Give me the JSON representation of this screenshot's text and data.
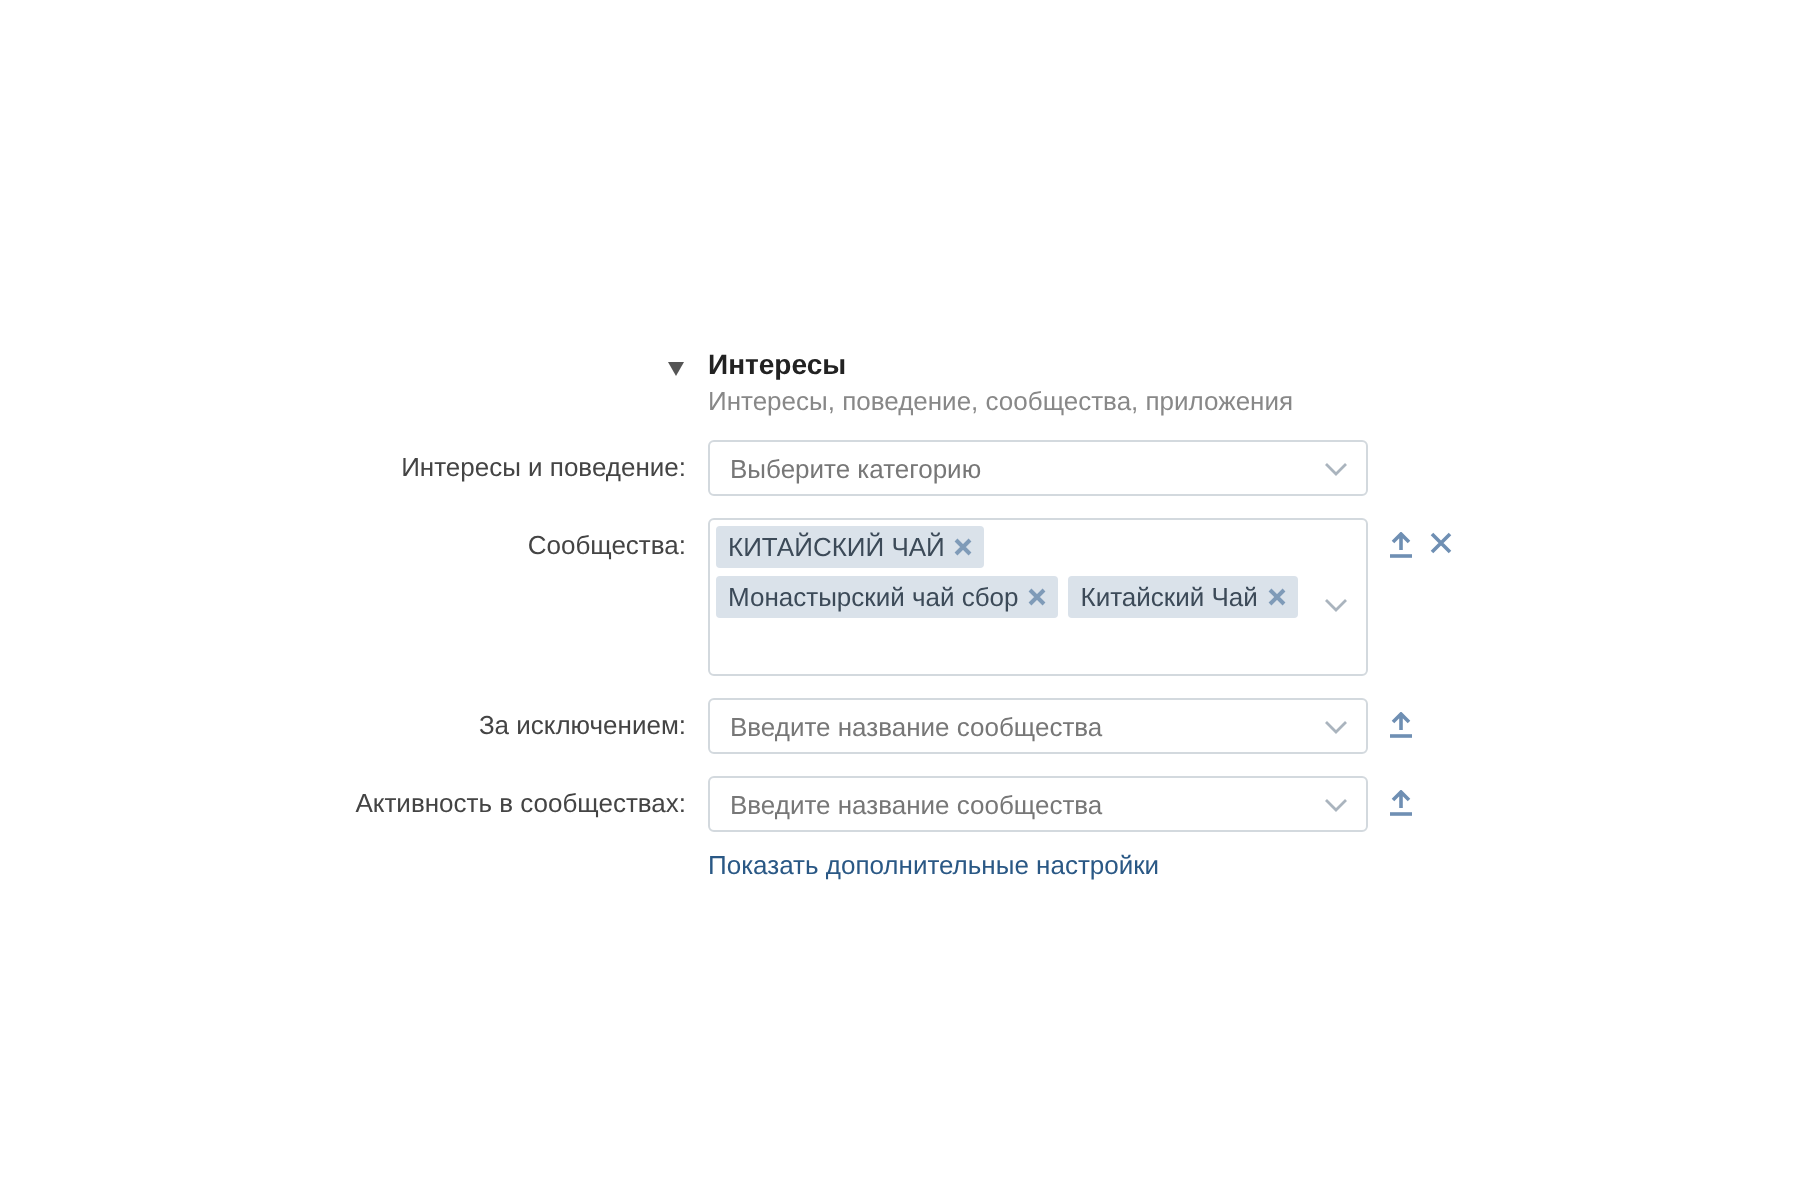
{
  "section": {
    "title": "Интересы",
    "subtitle": "Интересы, поведение, сообщества, приложения",
    "expanded": true
  },
  "fields": [
    {
      "label": "Интересы и поведение:",
      "kind": "select",
      "placeholder": "Выберите категорию",
      "upload": false,
      "clear": false
    },
    {
      "label": "Сообщества:",
      "kind": "tags",
      "tags": [
        "КИТАЙСКИЙ ЧАЙ",
        "Монастырский чай сбор",
        "Китайский Чай"
      ],
      "upload": true,
      "clear": true
    },
    {
      "label": "За исключением:",
      "kind": "select",
      "placeholder": "Введите название сообщества",
      "upload": true,
      "clear": false
    },
    {
      "label": "Активность в сообществах:",
      "kind": "select",
      "placeholder": "Введите название сообщества",
      "upload": true,
      "clear": false
    }
  ],
  "link": "Показать дополнительные настройки"
}
